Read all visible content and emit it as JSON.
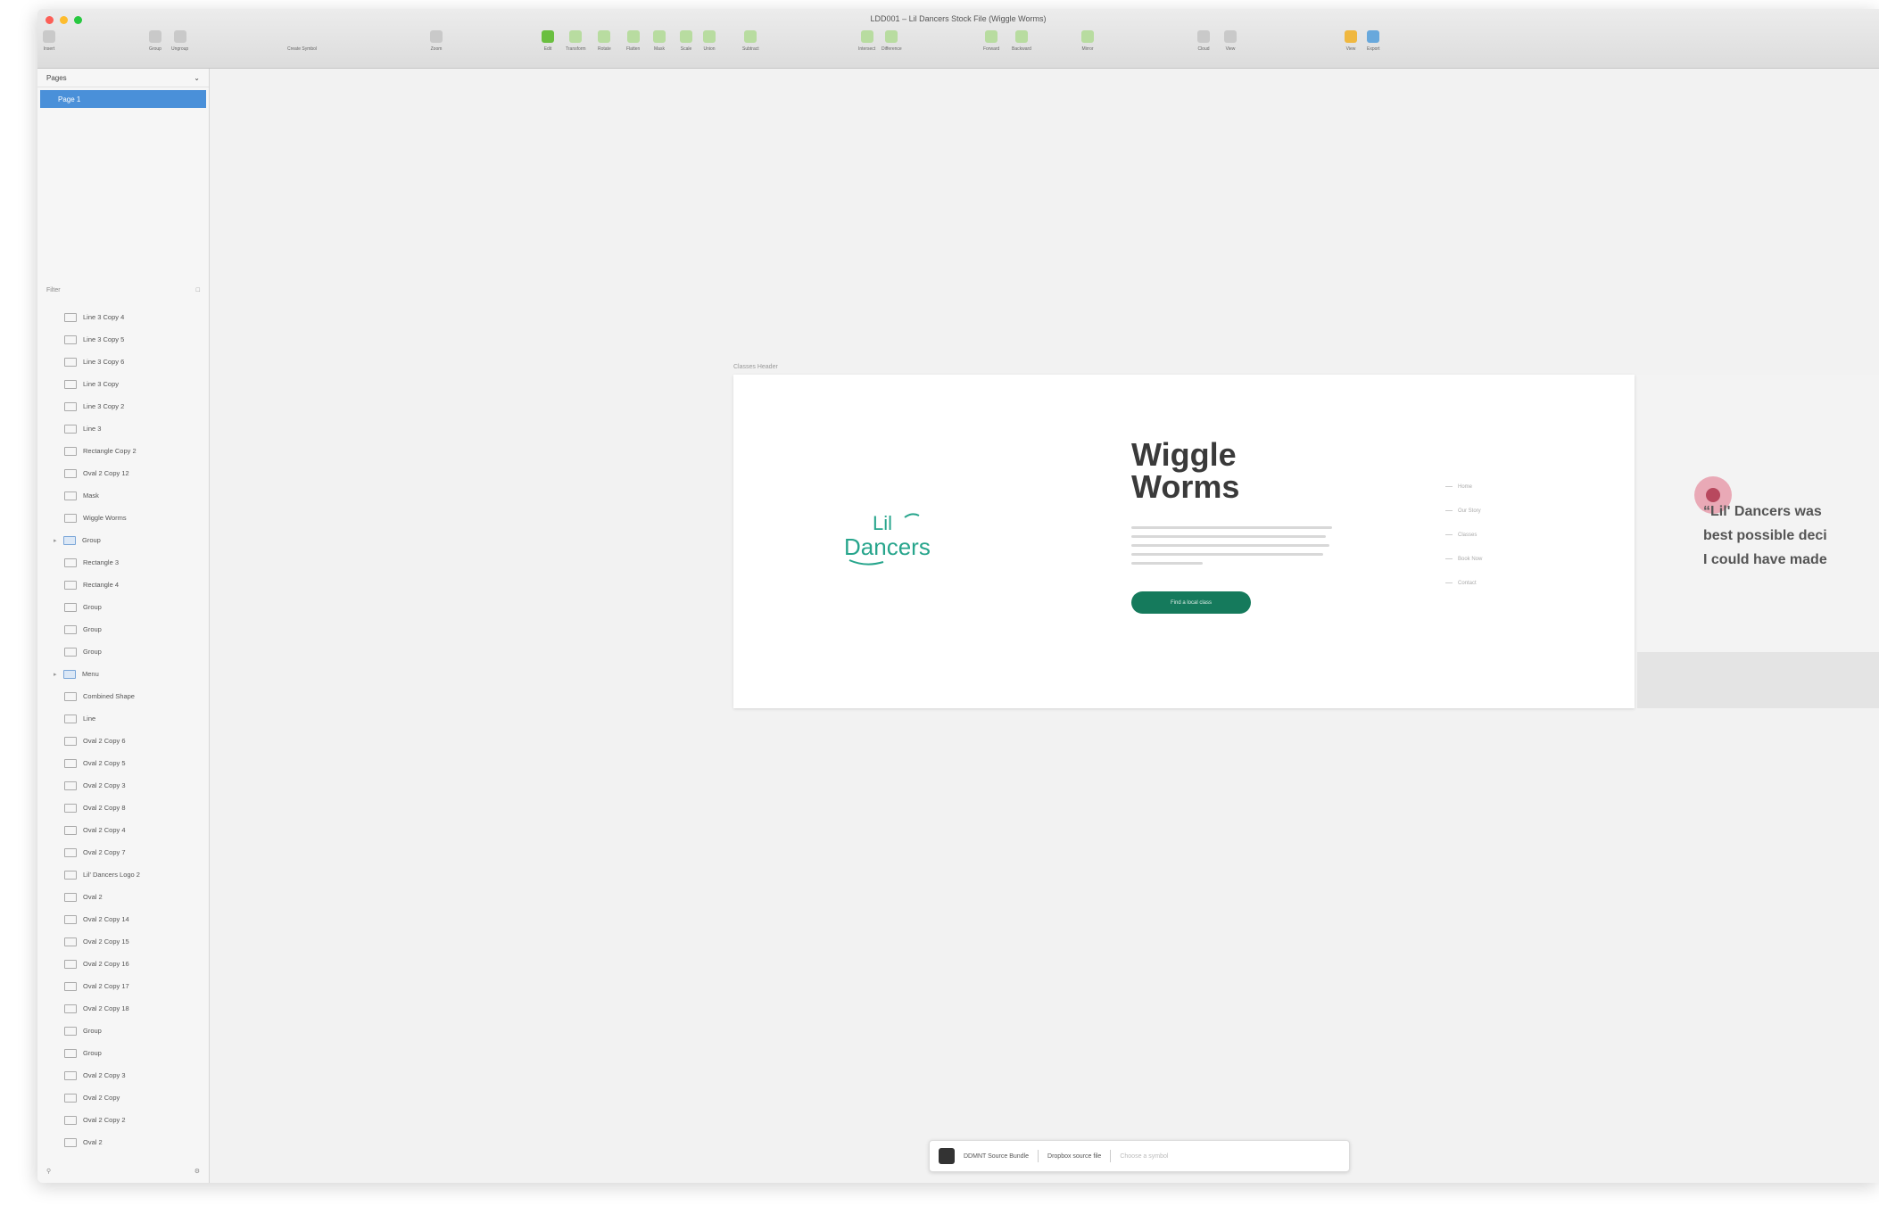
{
  "window": {
    "title": "LDD001 – Lil Dancers Stock File (Wiggle Worms)",
    "traffic_colors": [
      "#fc5f57",
      "#fdbc2e",
      "#28c840"
    ]
  },
  "toolbar": {
    "insert": "Insert",
    "group": "Group",
    "ungroup": "Ungroup",
    "create_symbol": "Create Symbol",
    "zoom": "Zoom",
    "edit": "Edit",
    "transform": "Transform",
    "rotate": "Rotate",
    "flatten": "Flatten",
    "mask": "Mask",
    "scale": "Scale",
    "union": "Union",
    "subtract": "Subtract",
    "intersect": "Intersect",
    "difference": "Difference",
    "forward": "Forward",
    "backward": "Backward",
    "mirror": "Mirror",
    "cloud": "Cloud",
    "view": "View",
    "export": "Export"
  },
  "sidebar": {
    "pages_label": "Pages",
    "current_page": "Page 1",
    "layers_label": "Filter",
    "layers": [
      {
        "name": "Line 3 Copy 4",
        "type": "shape",
        "expanded": false
      },
      {
        "name": "Line 3 Copy 5",
        "type": "shape",
        "expanded": false
      },
      {
        "name": "Line 3 Copy 6",
        "type": "shape",
        "expanded": false
      },
      {
        "name": "Line 3 Copy",
        "type": "shape",
        "expanded": false
      },
      {
        "name": "Line 3 Copy 2",
        "type": "shape",
        "expanded": false
      },
      {
        "name": "Line 3",
        "type": "shape",
        "expanded": false
      },
      {
        "name": "Rectangle Copy 2",
        "type": "shape",
        "expanded": false
      },
      {
        "name": "Oval 2 Copy 12",
        "type": "shape",
        "expanded": false
      },
      {
        "name": "Mask",
        "type": "shape",
        "expanded": false
      },
      {
        "name": "Wiggle Worms",
        "type": "shape",
        "expanded": false
      },
      {
        "name": "Group",
        "type": "group",
        "expanded": true
      },
      {
        "name": "Rectangle 3",
        "type": "shape",
        "expanded": false
      },
      {
        "name": "Rectangle 4",
        "type": "shape",
        "expanded": false
      },
      {
        "name": "Group",
        "type": "text",
        "expanded": false
      },
      {
        "name": "Group",
        "type": "text",
        "expanded": false
      },
      {
        "name": "Group",
        "type": "text",
        "expanded": false
      },
      {
        "name": "Menu",
        "type": "group",
        "expanded": true
      },
      {
        "name": "Combined Shape",
        "type": "shape",
        "expanded": false
      },
      {
        "name": "Line",
        "type": "shape",
        "expanded": false
      },
      {
        "name": "Oval 2 Copy 6",
        "type": "shape",
        "expanded": false
      },
      {
        "name": "Oval 2 Copy 5",
        "type": "shape",
        "expanded": false
      },
      {
        "name": "Oval 2 Copy 3",
        "type": "shape",
        "expanded": false
      },
      {
        "name": "Oval 2 Copy 8",
        "type": "shape",
        "expanded": false
      },
      {
        "name": "Oval 2 Copy 4",
        "type": "shape",
        "expanded": false
      },
      {
        "name": "Oval 2 Copy 7",
        "type": "shape",
        "expanded": false
      },
      {
        "name": "Lil' Dancers Logo 2",
        "type": "shape",
        "expanded": false
      },
      {
        "name": "Oval 2",
        "type": "shape",
        "expanded": false
      },
      {
        "name": "Oval 2 Copy 14",
        "type": "shape",
        "expanded": false
      },
      {
        "name": "Oval 2 Copy 15",
        "type": "shape",
        "expanded": false
      },
      {
        "name": "Oval 2 Copy 16",
        "type": "shape",
        "expanded": false
      },
      {
        "name": "Oval 2 Copy 17",
        "type": "shape",
        "expanded": false
      },
      {
        "name": "Oval 2 Copy 18",
        "type": "shape",
        "expanded": false
      },
      {
        "name": "Group",
        "type": "text",
        "expanded": false
      },
      {
        "name": "Group",
        "type": "text",
        "expanded": false
      },
      {
        "name": "Oval 2 Copy 3",
        "type": "shape",
        "expanded": false
      },
      {
        "name": "Oval 2 Copy",
        "type": "shape",
        "expanded": false
      },
      {
        "name": "Oval 2 Copy 2",
        "type": "shape",
        "expanded": false
      },
      {
        "name": "Oval 2",
        "type": "shape",
        "expanded": false
      }
    ]
  },
  "canvas": {
    "artboard_label": "Classes Header",
    "logo_text": [
      "Lil",
      "Dancers"
    ],
    "headline": [
      "Wiggle",
      "Worms"
    ],
    "cta_label": "Find a local class",
    "menu_items": [
      "Home",
      "Our Story",
      "Classes",
      "Book Now",
      "Contact"
    ],
    "quote_lines": [
      "“Lil' Dancers was",
      "best possible deci",
      "I could have made"
    ]
  },
  "inspector": {
    "symbol_name": "DDMNT Source Bundle",
    "override": "Dropbox source file",
    "placeholder": "Choose a symbol"
  },
  "colors": {
    "brand_green": "#157a5c",
    "logo_teal": "#27a58c",
    "selection_blue": "#4a90d9",
    "avatar_pink": "#e9a9b6"
  }
}
